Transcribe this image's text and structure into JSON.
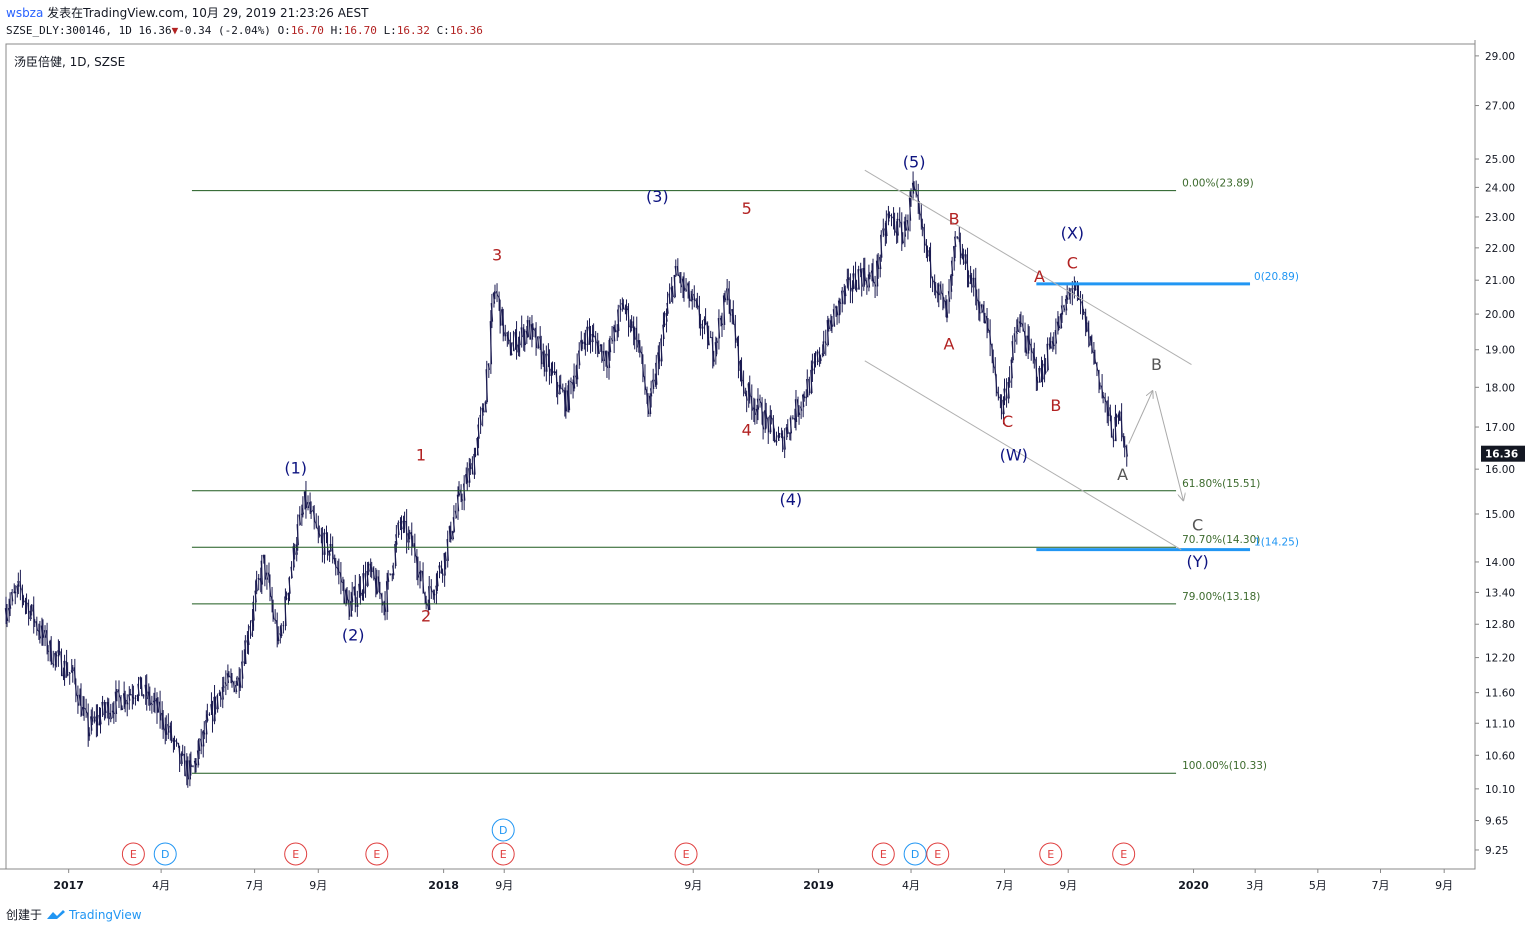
{
  "header": {
    "user": "wsbza",
    "published": "发表在TradingView.com, 10月 29, 2019 21:23:26 AEST",
    "symbol": "SZSE_DLY:300146, 1D",
    "last": "16.36",
    "change": "-0.34 (-2.04%)",
    "o_label": "O:",
    "o": "16.70",
    "h_label": "H:",
    "h": "16.70",
    "l_label": "L:",
    "l": "16.32",
    "c_label": "C:",
    "c": "16.36"
  },
  "footer": {
    "created_by": "创建于",
    "brand": "TradingView"
  },
  "chart_data": {
    "type": "candlestick",
    "title": "汤臣倍健, 1D, SZSE",
    "y_scale": "log",
    "ylim": [
      9.0,
      29.5
    ],
    "y_ticks": [
      29.0,
      27.0,
      25.0,
      24.0,
      23.0,
      22.0,
      21.0,
      20.0,
      19.0,
      18.0,
      17.0,
      16.0,
      15.0,
      14.0,
      13.4,
      12.8,
      12.2,
      11.6,
      11.1,
      10.6,
      10.1,
      9.65,
      9.25
    ],
    "last_price": 16.36,
    "x_range": [
      "2016-11-01",
      "2020-10-01"
    ],
    "x_ticks": [
      {
        "date": "2017-01-01",
        "label": "2017",
        "bold": true
      },
      {
        "date": "2017-04-01",
        "label": "4月"
      },
      {
        "date": "2017-07-01",
        "label": "7月"
      },
      {
        "date": "2017-09-01",
        "label": "9月"
      },
      {
        "date": "2018-01-01",
        "label": "2018",
        "bold": true
      },
      {
        "date": "2018-03-01",
        "label": "9月"
      },
      {
        "date": "2018-09-01",
        "label": "9月"
      },
      {
        "date": "2019-01-01",
        "label": "2019",
        "bold": true
      },
      {
        "date": "2019-04-01",
        "label": "4月"
      },
      {
        "date": "2019-07-01",
        "label": "7月"
      },
      {
        "date": "2019-09-01",
        "label": "9月"
      },
      {
        "date": "2020-01-01",
        "label": "2020",
        "bold": true
      },
      {
        "date": "2020-03-01",
        "label": "3月"
      },
      {
        "date": "2020-05-01",
        "label": "5月"
      },
      {
        "date": "2020-07-01",
        "label": "7月"
      },
      {
        "date": "2020-09-01",
        "label": "9月"
      }
    ],
    "price_path": [
      [
        "2016-11-01",
        13.1
      ],
      [
        "2016-11-15",
        13.45
      ],
      [
        "2016-12-01",
        12.8
      ],
      [
        "2016-12-15",
        12.3
      ],
      [
        "2017-01-05",
        11.9
      ],
      [
        "2017-01-20",
        11.0
      ],
      [
        "2017-02-05",
        11.3
      ],
      [
        "2017-02-20",
        11.5
      ],
      [
        "2017-03-10",
        11.7
      ],
      [
        "2017-03-25",
        11.4
      ],
      [
        "2017-04-08",
        11.0
      ],
      [
        "2017-04-20",
        10.5
      ],
      [
        "2017-05-01",
        10.33
      ],
      [
        "2017-05-15",
        11.0
      ],
      [
        "2017-05-30",
        11.7
      ],
      [
        "2017-06-15",
        11.8
      ],
      [
        "2017-06-28",
        12.9
      ],
      [
        "2017-07-10",
        14.0
      ],
      [
        "2017-07-25",
        12.4
      ],
      [
        "2017-08-10",
        14.4
      ],
      [
        "2017-08-20",
        15.3
      ],
      [
        "2017-09-01",
        14.5
      ],
      [
        "2017-09-15",
        14.2
      ],
      [
        "2017-10-01",
        13.1
      ],
      [
        "2017-10-20",
        13.8
      ],
      [
        "2017-11-05",
        13.2
      ],
      [
        "2017-11-20",
        14.8
      ],
      [
        "2017-12-05",
        14.2
      ],
      [
        "2017-12-15",
        13.2
      ],
      [
        "2018-01-01",
        14.0
      ],
      [
        "2018-01-15",
        15.2
      ],
      [
        "2018-01-28",
        16.0
      ],
      [
        "2018-02-10",
        17.5
      ],
      [
        "2018-02-20",
        20.8
      ],
      [
        "2018-03-05",
        19.0
      ],
      [
        "2018-03-25",
        19.6
      ],
      [
        "2018-04-15",
        18.4
      ],
      [
        "2018-05-01",
        17.6
      ],
      [
        "2018-05-20",
        19.5
      ],
      [
        "2018-06-10",
        18.8
      ],
      [
        "2018-06-25",
        20.3
      ],
      [
        "2018-07-10",
        19.2
      ],
      [
        "2018-07-20",
        17.3
      ],
      [
        "2018-08-05",
        19.8
      ],
      [
        "2018-08-15",
        21.2
      ],
      [
        "2018-09-01",
        20.3
      ],
      [
        "2018-09-20",
        19.0
      ],
      [
        "2018-10-05",
        20.6
      ],
      [
        "2018-10-20",
        18.0
      ],
      [
        "2018-11-10",
        17.2
      ],
      [
        "2018-11-25",
        16.6
      ],
      [
        "2018-12-10",
        17.4
      ],
      [
        "2018-12-25",
        18.2
      ],
      [
        "2019-01-10",
        19.5
      ],
      [
        "2019-01-25",
        20.5
      ],
      [
        "2019-02-10",
        21.2
      ],
      [
        "2019-02-25",
        21.0
      ],
      [
        "2019-03-10",
        23.0
      ],
      [
        "2019-03-25",
        22.4
      ],
      [
        "2019-04-03",
        23.89
      ],
      [
        "2019-04-15",
        22.0
      ],
      [
        "2019-04-25",
        21.0
      ],
      [
        "2019-05-06",
        19.9
      ],
      [
        "2019-05-15",
        22.2
      ],
      [
        "2019-05-30",
        21.0
      ],
      [
        "2019-06-15",
        19.5
      ],
      [
        "2019-06-28",
        17.4
      ],
      [
        "2019-07-05",
        18.2
      ],
      [
        "2019-07-15",
        19.8
      ],
      [
        "2019-07-25",
        19.0
      ],
      [
        "2019-08-05",
        18.2
      ],
      [
        "2019-08-15",
        19.2
      ],
      [
        "2019-08-25",
        19.8
      ],
      [
        "2019-09-05",
        20.89
      ],
      [
        "2019-09-15",
        20.0
      ],
      [
        "2019-09-25",
        19.0
      ],
      [
        "2019-10-08",
        17.4
      ],
      [
        "2019-10-15",
        16.9
      ],
      [
        "2019-10-22",
        17.2
      ],
      [
        "2019-10-29",
        16.36
      ]
    ],
    "fib_retracement": {
      "start": "2017-05-01",
      "end": "2019-12-15",
      "levels": [
        {
          "price": 23.89,
          "label": "0.00%(23.89)"
        },
        {
          "price": 15.51,
          "label": "61.80%(15.51)"
        },
        {
          "price": 14.3,
          "label": "70.70%(14.30)"
        },
        {
          "price": 13.18,
          "label": "79.00%(13.18)"
        },
        {
          "price": 10.33,
          "label": "100.00%(10.33)"
        }
      ]
    },
    "fib_extension": {
      "start": "2019-08-01",
      "end": "2020-02-25",
      "levels": [
        {
          "price": 20.89,
          "label": "0(20.89)"
        },
        {
          "price": 14.25,
          "label": "1(14.25)"
        }
      ]
    },
    "channel": [
      {
        "p1": [
          "2019-02-15",
          24.6
        ],
        "p2": [
          "2019-12-30",
          18.6
        ]
      },
      {
        "p1": [
          "2019-02-15",
          18.7
        ],
        "p2": [
          "2019-12-20",
          14.25
        ]
      }
    ],
    "projection": [
      [
        [
          "2019-10-30",
          16.6
        ],
        [
          "2019-11-22",
          17.9
        ]
      ],
      [
        [
          "2019-11-25",
          17.9
        ],
        [
          "2019-12-22",
          15.3
        ]
      ]
    ],
    "wave_labels": [
      {
        "text": "(1)",
        "date": "2017-08-10",
        "price": 15.9,
        "color": "#0d1380"
      },
      {
        "text": "(2)",
        "date": "2017-10-05",
        "price": 12.5,
        "color": "#0d1380"
      },
      {
        "text": "(3)",
        "date": "2018-07-28",
        "price": 23.5,
        "color": "#0d1380"
      },
      {
        "text": "(4)",
        "date": "2018-12-05",
        "price": 15.2,
        "color": "#0d1380"
      },
      {
        "text": "(5)",
        "date": "2019-04-04",
        "price": 24.7,
        "color": "#0d1380"
      },
      {
        "text": "(W)",
        "date": "2019-07-10",
        "price": 16.2,
        "color": "#0d1380"
      },
      {
        "text": "(X)",
        "date": "2019-09-05",
        "price": 22.3,
        "color": "#0d1380"
      },
      {
        "text": "(Y)",
        "date": "2020-01-05",
        "price": 13.9,
        "color": "#0d1380"
      },
      {
        "text": "1",
        "date": "2017-12-10",
        "price": 16.2,
        "color": "#b22222"
      },
      {
        "text": "2",
        "date": "2017-12-15",
        "price": 12.85,
        "color": "#b22222"
      },
      {
        "text": "3",
        "date": "2018-02-22",
        "price": 21.6,
        "color": "#b22222"
      },
      {
        "text": "4",
        "date": "2018-10-23",
        "price": 16.8,
        "color": "#b22222"
      },
      {
        "text": "5",
        "date": "2018-10-23",
        "price": 23.1,
        "color": "#b22222"
      },
      {
        "text": "B",
        "date": "2019-05-13",
        "price": 22.75,
        "color": "#b22222"
      },
      {
        "text": "A",
        "date": "2019-05-08",
        "price": 19.0,
        "color": "#b22222"
      },
      {
        "text": "C",
        "date": "2019-07-04",
        "price": 17.0,
        "color": "#b22222"
      },
      {
        "text": "A",
        "date": "2019-08-04",
        "price": 20.95,
        "color": "#b22222"
      },
      {
        "text": "B",
        "date": "2019-08-20",
        "price": 17.4,
        "color": "#b22222"
      },
      {
        "text": "C",
        "date": "2019-09-05",
        "price": 21.35,
        "color": "#b22222"
      },
      {
        "text": "A",
        "date": "2019-10-24",
        "price": 15.75,
        "color": "#555555"
      },
      {
        "text": "B",
        "date": "2019-11-26",
        "price": 18.45,
        "color": "#555555"
      },
      {
        "text": "C",
        "date": "2020-01-05",
        "price": 14.65,
        "color": "#555555"
      }
    ],
    "events": [
      {
        "type": "E",
        "date": "2017-03-05"
      },
      {
        "type": "D",
        "date": "2017-04-05"
      },
      {
        "type": "E",
        "date": "2017-08-10"
      },
      {
        "type": "E",
        "date": "2017-10-28"
      },
      {
        "type": "E",
        "date": "2018-02-28",
        "stack": 0
      },
      {
        "type": "D",
        "date": "2018-02-28",
        "stack": 1
      },
      {
        "type": "E",
        "date": "2018-08-25"
      },
      {
        "type": "E",
        "date": "2019-03-05"
      },
      {
        "type": "D",
        "date": "2019-04-05"
      },
      {
        "type": "E",
        "date": "2019-04-27"
      },
      {
        "type": "E",
        "date": "2019-08-15"
      },
      {
        "type": "E",
        "date": "2019-10-25"
      }
    ],
    "colors": {
      "candle": "#1a1a50",
      "fib_retracement": "#1e5a1e",
      "fib_text": "#3d6b2e",
      "fib_extension": "#2196f3",
      "channel": "#b0b0b0",
      "projection": "#aaaaaa",
      "last_tag": "#131722",
      "event_E": "#e04040",
      "event_D": "#2196f3"
    }
  }
}
